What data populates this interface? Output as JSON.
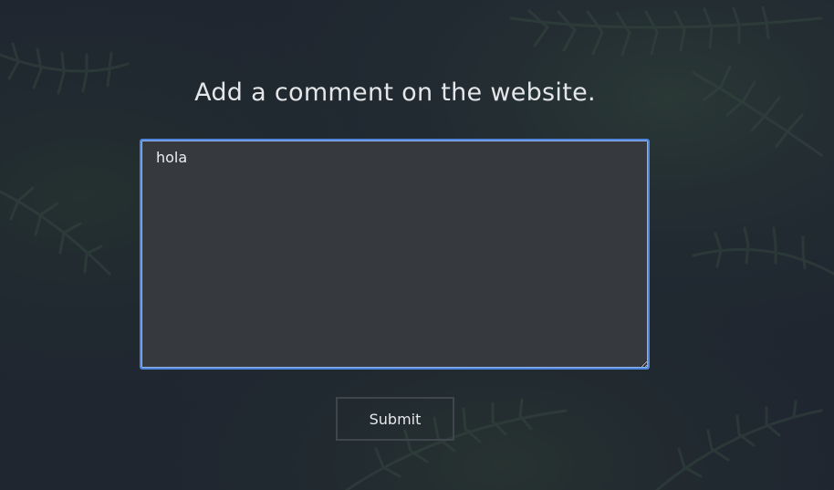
{
  "page": {
    "heading": "Add a comment on the website."
  },
  "comment": {
    "value": "hola",
    "placeholder": ""
  },
  "actions": {
    "submit_label": "Submit"
  },
  "theme": {
    "background": "#1f2630",
    "textarea_background": "#363a3e",
    "focus_border": "#4f86dc",
    "button_border": "#3f464c",
    "text_color": "#e4e6e8"
  },
  "background_image": {
    "subject": "evergreen-branches"
  }
}
